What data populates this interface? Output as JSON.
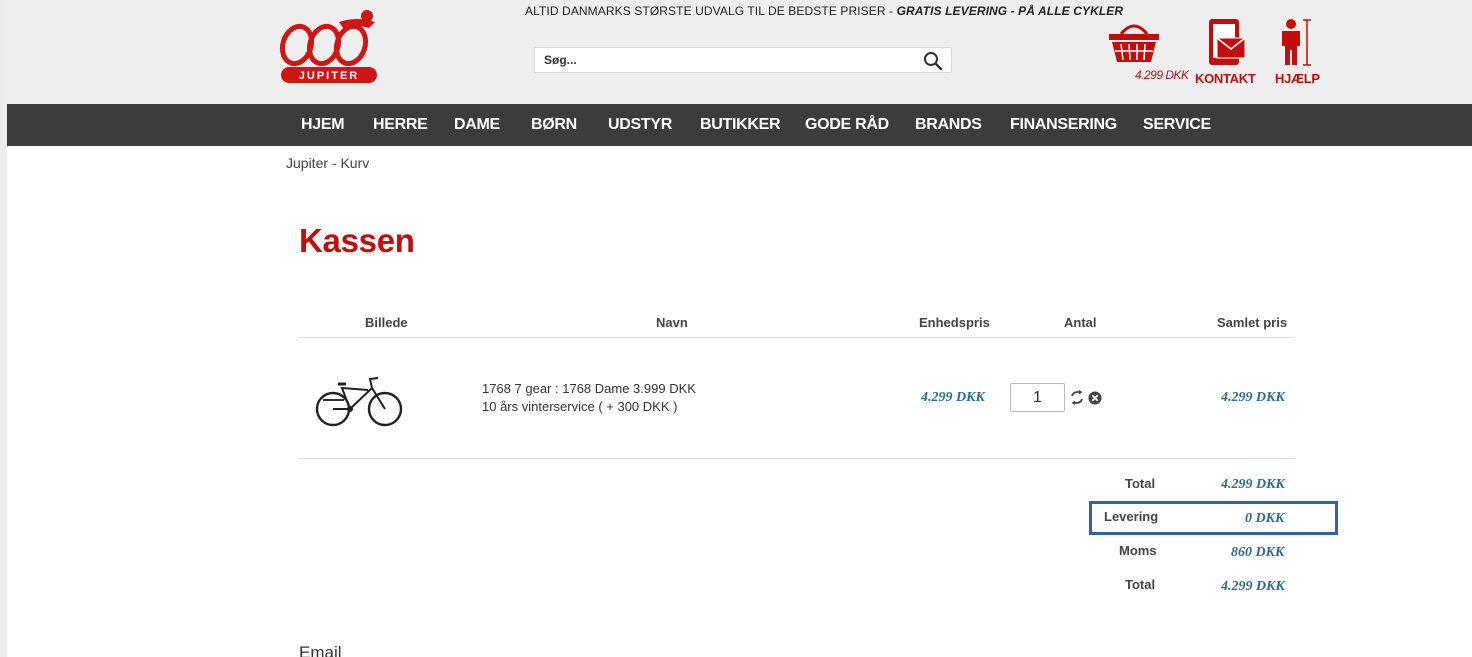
{
  "header": {
    "tagline_plain": "ALTID DANMARKS STØRSTE UDVALG TIL DE BEDSTE PRISER  - ",
    "tagline_strong": "GRATIS LEVERING - PÅ ALLE CYKLER",
    "logo_text": "JUPITER",
    "search_placeholder": "Søg...",
    "cart_amount": "4.299 DKK",
    "contact_label": "KONTAKT",
    "help_label": "HJÆLP",
    "brand_color": "#c30d0d"
  },
  "nav": {
    "items": [
      "HJEM",
      "HERRE",
      "DAME",
      "BØRN",
      "UDSTYR",
      "BUTIKKER",
      "GODE RÅD",
      "BRANDS",
      "FINANSERING",
      "SERVICE"
    ]
  },
  "breadcrumb": "Jupiter - Kurv",
  "page_title": "Kassen",
  "table": {
    "headers": [
      "Billede",
      "Navn",
      "Enhedspris",
      "Antal",
      "Samlet pris"
    ],
    "rows": [
      {
        "name_line1": "1768 7 gear : 1768 Dame 3.999 DKK",
        "name_line2": "10 års vinterservice ( + 300 DKK )",
        "unit_price": "4.299 DKK",
        "quantity": "1",
        "total_price": "4.299 DKK"
      }
    ]
  },
  "summary": {
    "total_label": "Total",
    "total_value": "4.299 DKK",
    "delivery_label": "Levering",
    "delivery_value": "0 DKK",
    "vat_label": "Moms",
    "vat_value": "860 DKK",
    "grand_total_label": "Total",
    "grand_total_value": "4.299 DKK",
    "highlight_color": "#2f63a6"
  },
  "form": {
    "email_label": "Email"
  }
}
